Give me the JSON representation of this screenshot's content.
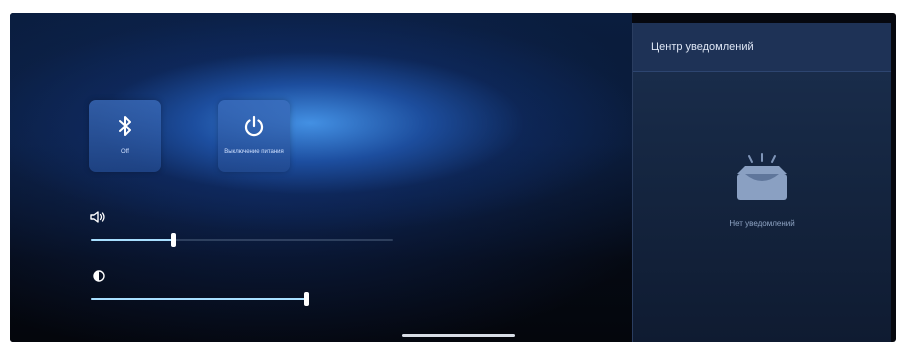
{
  "control_panel": {
    "bluetooth": {
      "icon": "bluetooth-icon",
      "label": "Off"
    },
    "power": {
      "icon": "power-icon",
      "label": "Выключение питания"
    },
    "volume": {
      "icon": "speaker-icon",
      "level": 0.27
    },
    "brightness": {
      "icon": "brightness-icon",
      "level": 1.0
    }
  },
  "notification_center": {
    "title": "Центр уведомлений",
    "empty_icon": "tray-icon",
    "empty_text": "Нет уведомлений"
  },
  "colors": {
    "accent": "#a8dfff",
    "panel_bg": "#152641",
    "tile_bg": "#3c6ebe"
  }
}
